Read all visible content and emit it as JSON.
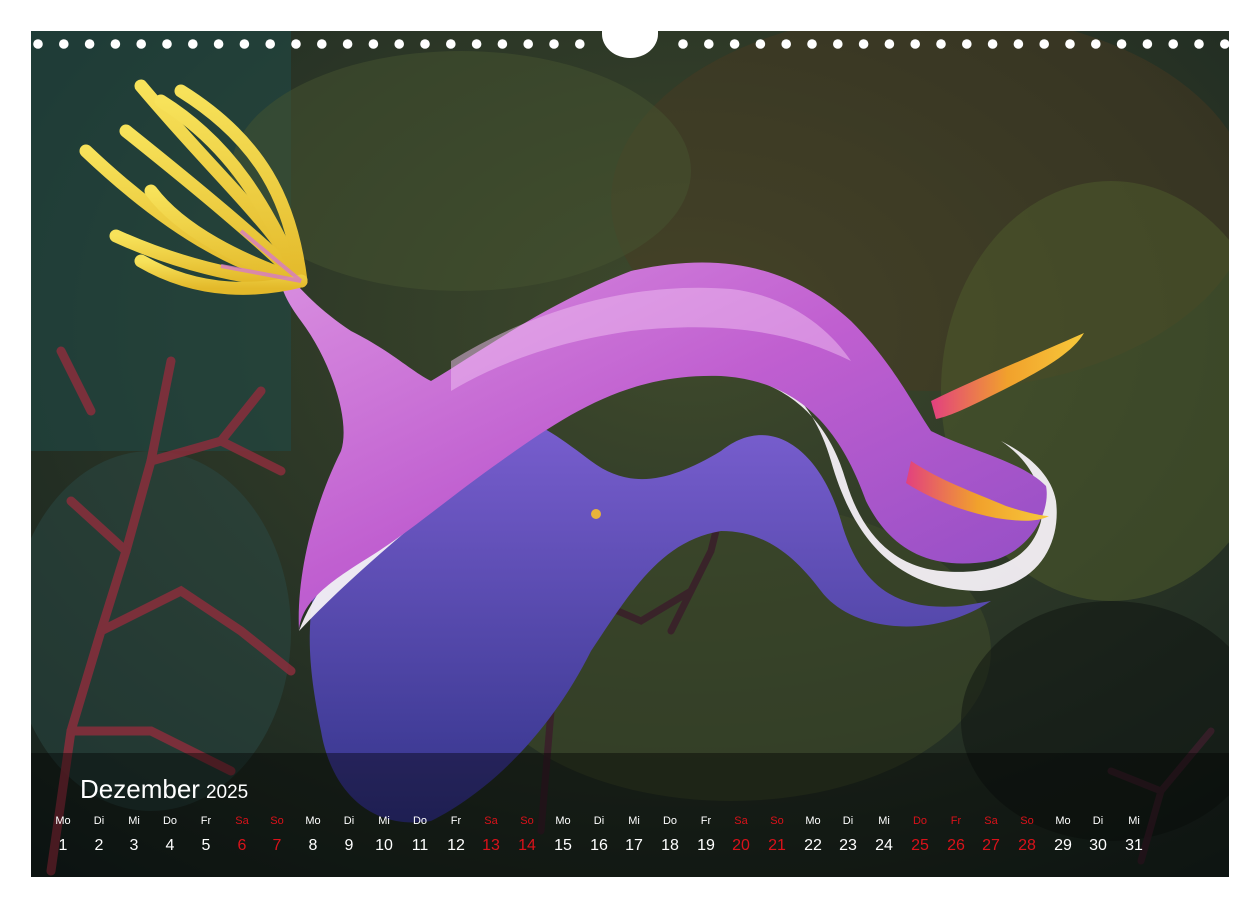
{
  "calendar": {
    "month": "Dezember",
    "year": "2025",
    "days": [
      {
        "n": "1",
        "d": "Mo",
        "we": false
      },
      {
        "n": "2",
        "d": "Di",
        "we": false
      },
      {
        "n": "3",
        "d": "Mi",
        "we": false
      },
      {
        "n": "4",
        "d": "Do",
        "we": false
      },
      {
        "n": "5",
        "d": "Fr",
        "we": false
      },
      {
        "n": "6",
        "d": "Sa",
        "we": true
      },
      {
        "n": "7",
        "d": "So",
        "we": true
      },
      {
        "n": "8",
        "d": "Mo",
        "we": false
      },
      {
        "n": "9",
        "d": "Di",
        "we": false
      },
      {
        "n": "10",
        "d": "Mi",
        "we": false
      },
      {
        "n": "11",
        "d": "Do",
        "we": false
      },
      {
        "n": "12",
        "d": "Fr",
        "we": false
      },
      {
        "n": "13",
        "d": "Sa",
        "we": true
      },
      {
        "n": "14",
        "d": "So",
        "we": true
      },
      {
        "n": "15",
        "d": "Mo",
        "we": false
      },
      {
        "n": "16",
        "d": "Di",
        "we": false
      },
      {
        "n": "17",
        "d": "Mi",
        "we": false
      },
      {
        "n": "18",
        "d": "Do",
        "we": false
      },
      {
        "n": "19",
        "d": "Fr",
        "we": false
      },
      {
        "n": "20",
        "d": "Sa",
        "we": true
      },
      {
        "n": "21",
        "d": "So",
        "we": true
      },
      {
        "n": "22",
        "d": "Mo",
        "we": false
      },
      {
        "n": "23",
        "d": "Di",
        "we": false
      },
      {
        "n": "24",
        "d": "Mi",
        "we": false
      },
      {
        "n": "25",
        "d": "Do",
        "we": true
      },
      {
        "n": "26",
        "d": "Fr",
        "we": true
      },
      {
        "n": "27",
        "d": "Sa",
        "we": true
      },
      {
        "n": "28",
        "d": "So",
        "we": true
      },
      {
        "n": "29",
        "d": "Mo",
        "we": false
      },
      {
        "n": "30",
        "d": "Di",
        "we": false
      },
      {
        "n": "31",
        "d": "Mi",
        "we": false
      }
    ]
  },
  "colors": {
    "weekend": "#d9121a",
    "text": "#ffffff",
    "nudibranch_body": "#c76ad6",
    "nudibranch_gills": "#f2d23a"
  }
}
